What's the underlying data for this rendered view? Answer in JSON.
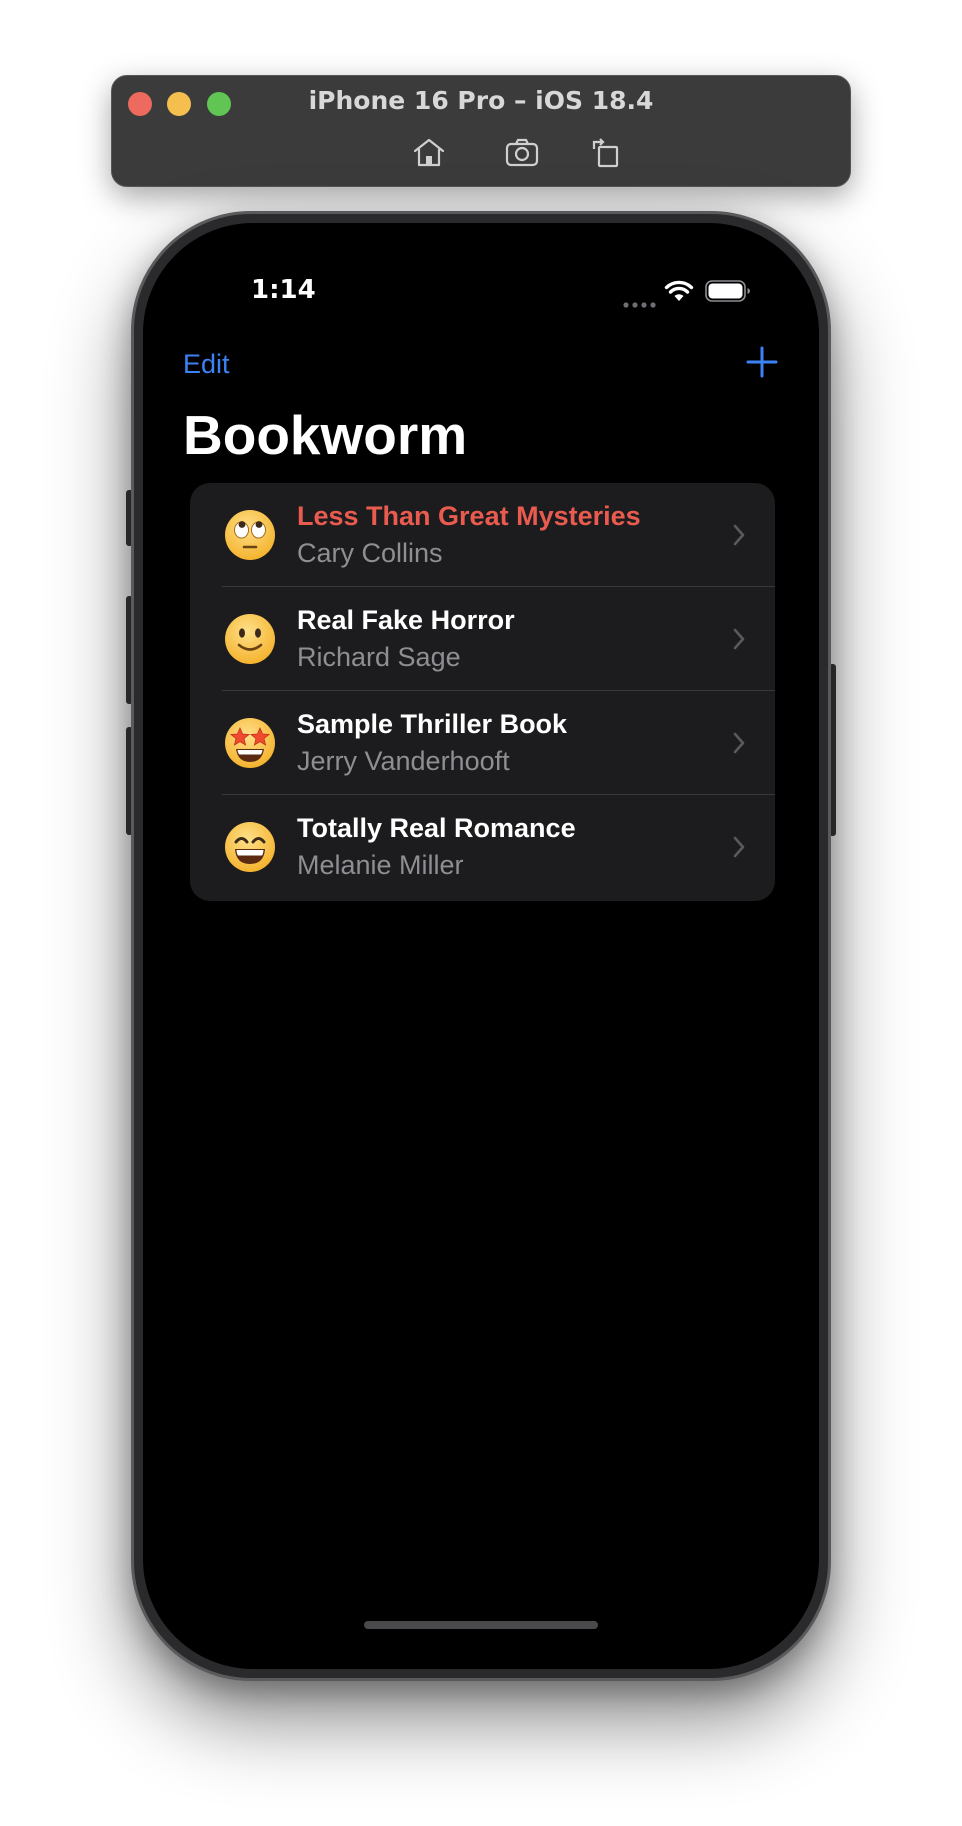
{
  "simulator": {
    "title": "iPhone 16 Pro – iOS 18.4",
    "toolbar": [
      "home-icon",
      "screenshot-icon",
      "rotate-icon"
    ]
  },
  "status_bar": {
    "time": "1:14"
  },
  "nav": {
    "edit_label": "Edit",
    "add_icon": "plus-icon",
    "title": "Bookworm"
  },
  "colors": {
    "accent": "#3b82f6",
    "warning_title": "#ea5b4f",
    "list_background": "#1c1c1e",
    "secondary_text": "#8e8e93"
  },
  "books": [
    {
      "title": "Less Than Great Mysteries",
      "author": "Cary Collins",
      "rating_icon": "eye-roll-face-icon",
      "highlight": true
    },
    {
      "title": "Real Fake Horror",
      "author": "Richard Sage",
      "rating_icon": "slightly-smiling-face-icon",
      "highlight": false
    },
    {
      "title": "Sample Thriller Book",
      "author": "Jerry Vanderhooft",
      "rating_icon": "star-struck-face-icon",
      "highlight": false
    },
    {
      "title": "Totally Real Romance",
      "author": "Melanie Miller",
      "rating_icon": "grinning-face-icon",
      "highlight": false
    }
  ]
}
